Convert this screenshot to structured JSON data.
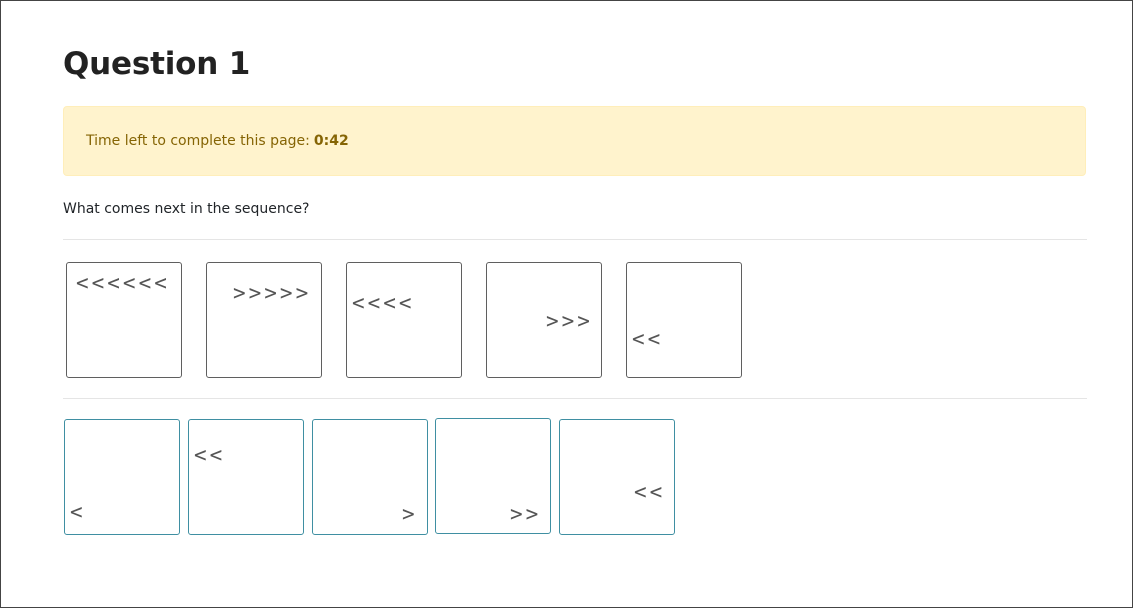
{
  "page": {
    "title": "Question 1",
    "timer_label": "Time left to complete this page:",
    "timer_value": "0:42",
    "question": "What comes next in the sequence?"
  },
  "sequence": [
    {
      "symbols": "<<<<<<"
    },
    {
      "symbols": ">>>>>"
    },
    {
      "symbols": "<<<<"
    },
    {
      "symbols": ">>>"
    },
    {
      "symbols": "<<"
    }
  ],
  "options": [
    {
      "symbols": "<"
    },
    {
      "symbols": "<<"
    },
    {
      "symbols": ">"
    },
    {
      "symbols": ">>"
    },
    {
      "symbols": "<<"
    }
  ],
  "colors": {
    "alert_background": "#fff3cd",
    "alert_text": "#856404",
    "option_border": "#3f8fa2",
    "sequence_border": "#5f5f5f"
  }
}
